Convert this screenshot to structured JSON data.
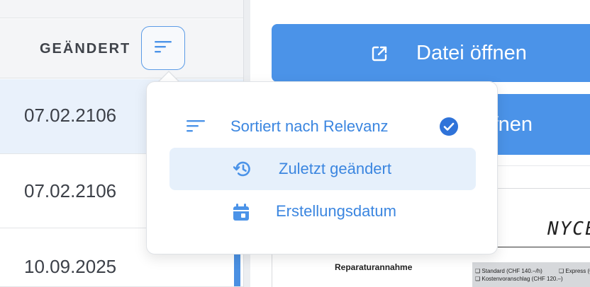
{
  "file_list": {
    "column_header": "GEÄNDERT",
    "sort_button_icon": "sort-icon",
    "rows": [
      {
        "date": "07.02.2106",
        "selected": true
      },
      {
        "date": "07.02.2106",
        "selected": false
      },
      {
        "date": "10.09.2025",
        "selected": false
      }
    ]
  },
  "actions": {
    "open_file_label": "Datei öffnen",
    "open_file_icon": "open-external-icon",
    "second_button_partial_label": "ffnen"
  },
  "sort_menu": {
    "items": [
      {
        "label": "Sortiert nach Relevanz",
        "icon": "sort-icon",
        "checked": true
      },
      {
        "label": "Zuletzt geändert",
        "icon": "history-icon",
        "highlighted": true
      },
      {
        "label": "Erstellungsdatum",
        "icon": "calendar-icon"
      }
    ]
  },
  "document_preview": {
    "logo_text": "NYCE",
    "heading": "Reparaturannahme",
    "options": [
      "❑ Standard (CHF 140.–/h)",
      "❑ Kostenvoranschlag (CHF 120.–)",
      "❑ Express (CHF"
    ]
  },
  "colors": {
    "accent": "#4b93e8",
    "menu_text": "#3b86e0",
    "selected_row": "#e9f1fb",
    "menu_highlight": "#e6f0fb"
  }
}
